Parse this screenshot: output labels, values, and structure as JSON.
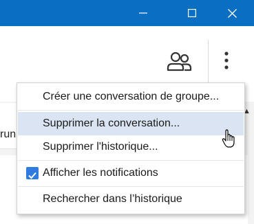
{
  "window": {
    "controls": [
      "minimize-icon",
      "maximize-icon",
      "close-icon"
    ],
    "titlebar_color": "#0a6fc2"
  },
  "header": {
    "icons": [
      "people-icon",
      "more-options-icon"
    ]
  },
  "background": {
    "partial_text": "run"
  },
  "menu": {
    "items": [
      {
        "label": "Créer une conversation de groupe..."
      },
      {
        "label": "Supprimer la conversation..."
      },
      {
        "label": "Supprimer l'historique..."
      },
      {
        "label": "Afficher les notifications",
        "checked": true
      },
      {
        "label": "Rechercher dans l’historique"
      }
    ],
    "highlighted_index": 1,
    "highlight_color": "#dbe4f3",
    "checkbox_color": "#2f7be0"
  }
}
